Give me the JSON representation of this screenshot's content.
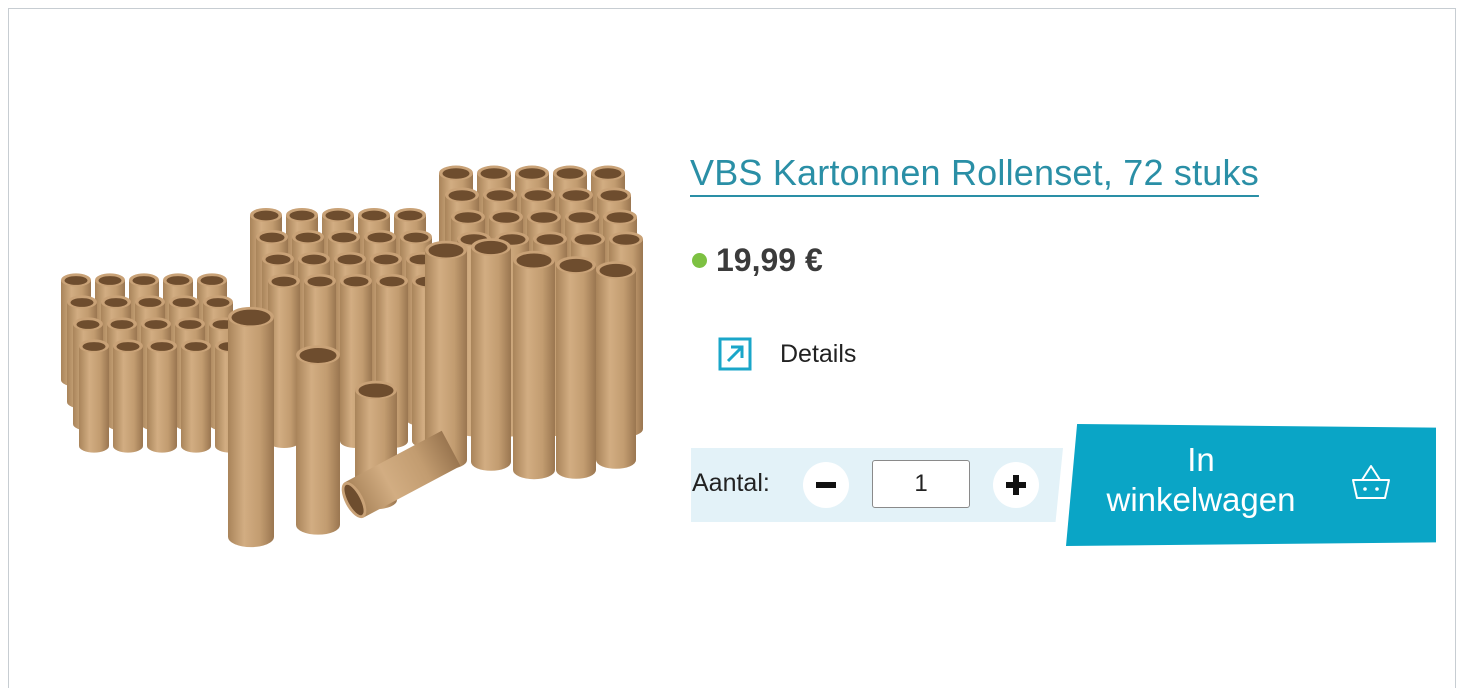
{
  "product": {
    "title": "VBS Kartonnen Rollenset, 72 stuks",
    "price": "19,99 €",
    "availability_color": "#7dc142",
    "image_icon": "cardboard-tubes-image"
  },
  "details": {
    "label": "Details",
    "icon": "external-arrow-icon"
  },
  "quantity": {
    "label": "Aantal:",
    "value": "1",
    "decrement_icon": "minus-icon",
    "increment_icon": "plus-icon"
  },
  "cart": {
    "line1": "In",
    "line2": "winkelwagen",
    "icon": "basket-icon"
  },
  "colors": {
    "accent": "#0aa5c6",
    "title": "#2a8fa6",
    "quantity_bar": "#e3f2f8"
  }
}
